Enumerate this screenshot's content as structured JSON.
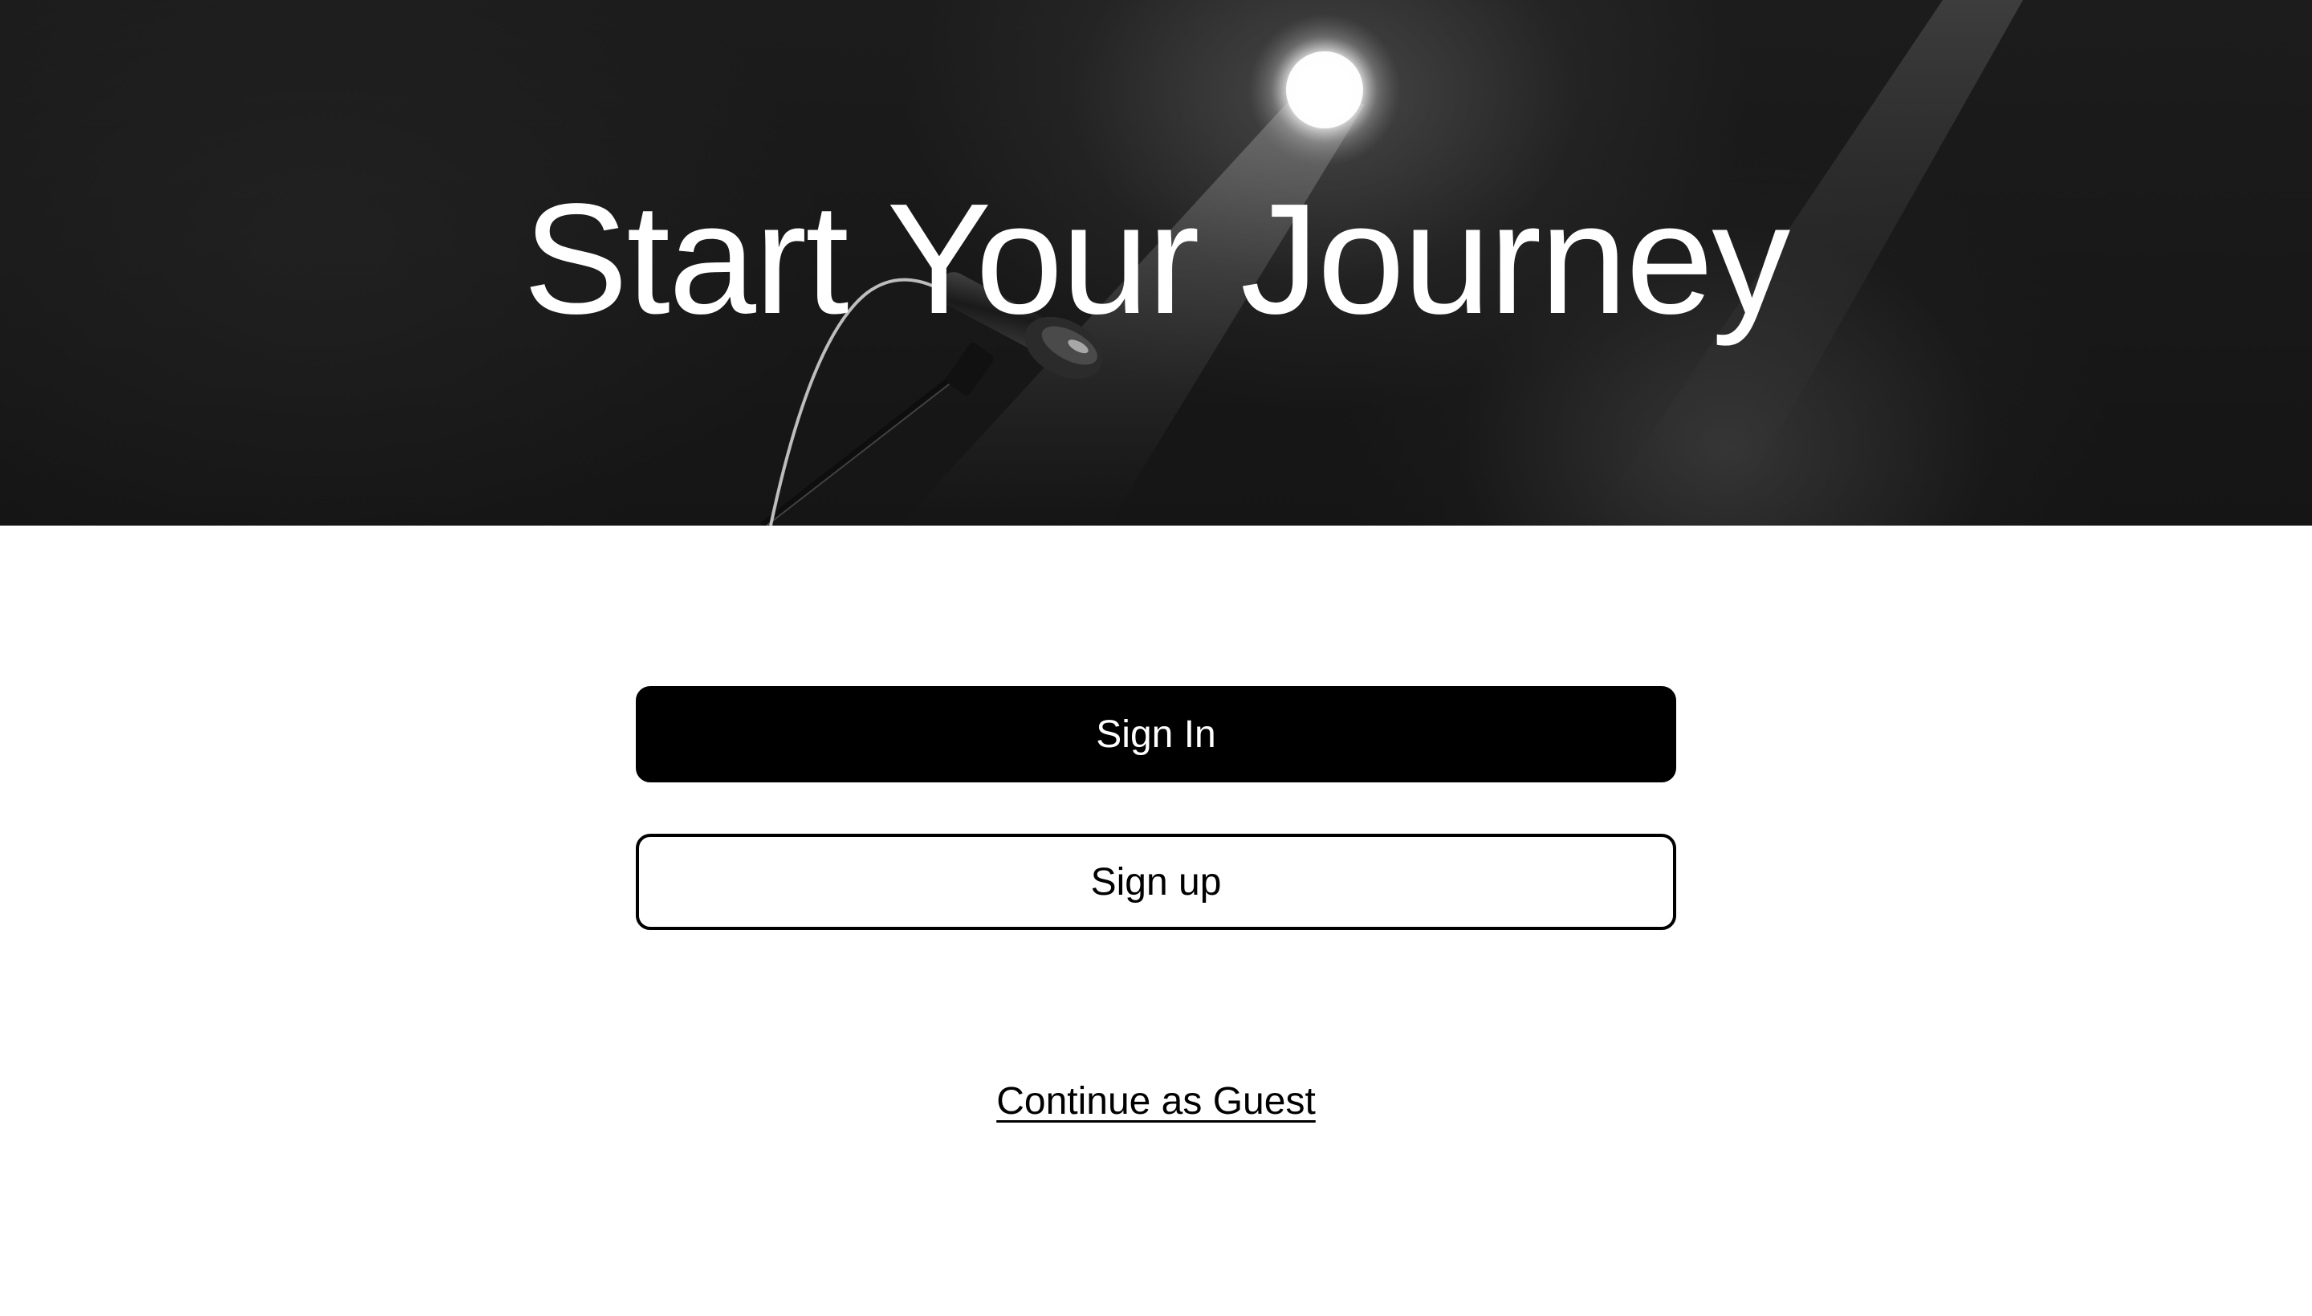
{
  "hero": {
    "title": "Start Your Journey",
    "image_description_icon": "microphone-stage-icon"
  },
  "actions": {
    "sign_in_label": "Sign In",
    "sign_up_label": "Sign up",
    "guest_label": "Continue as Guest"
  },
  "colors": {
    "primary": "#000000",
    "background": "#ffffff",
    "hero_text": "#ffffff"
  }
}
